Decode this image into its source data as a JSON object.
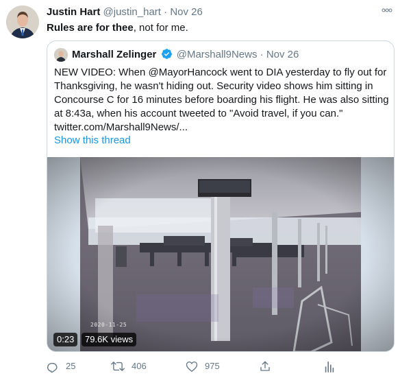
{
  "tweet": {
    "author_name": "Justin Hart",
    "handle": "@justin_hart",
    "separator": "·",
    "date": "Nov 26",
    "text_bold": "Rules are for thee",
    "text_rest": ", not for me.",
    "more_icon": "more-icon"
  },
  "quote": {
    "author_name": "Marshall Zelinger",
    "handle": "@Marshall9News",
    "separator": "·",
    "date": "Nov 26",
    "verified": true,
    "text": "NEW VIDEO: When @MayorHancock went to DIA yesterday to fly out for Thanksgiving, he wasn't hiding out. Security video shows him sitting in Concourse C for 16 minutes before boarding his flight. He was also sitting at 8:43a, when his account tweeted to \"Avoid travel, if you can.\"  twitter.com/Marshall9News/...",
    "show_thread": "Show this thread",
    "video": {
      "duration": "0:23",
      "views": "79.6K views",
      "overlay_date": "2020-11-25"
    }
  },
  "actions": {
    "reply_count": "25",
    "retweet_count": "406",
    "like_count": "975"
  },
  "colors": {
    "link": "#1b95e0",
    "muted": "#657786",
    "border": "#ccd6dd",
    "verified": "#1da1f2"
  }
}
